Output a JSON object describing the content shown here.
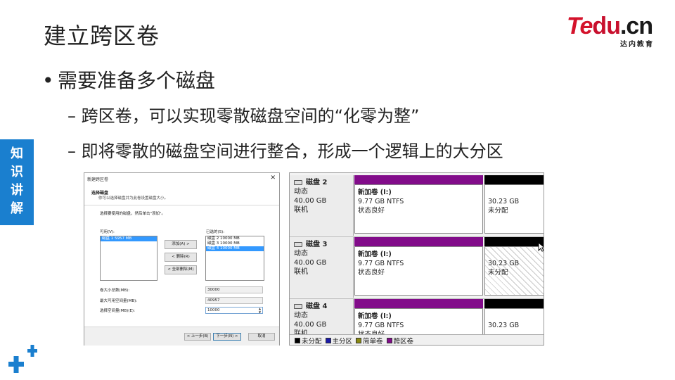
{
  "slide": {
    "title": "建立跨区卷",
    "bullet1": "需要准备多个磁盘",
    "bullet1_mark": "•",
    "sub_bullets": [
      "– 跨区卷，可以实现零散磁盘空间的“化零为整”",
      "– 即将零散的磁盘空间进行整合，形成一个逻辑上的大分区"
    ],
    "side_tab": [
      "知",
      "识",
      "讲",
      "解"
    ],
    "logo": {
      "te": "Te",
      "du": "du",
      "dot": ".",
      "cn": "cn",
      "sub": "达内教育"
    }
  },
  "wizard": {
    "title": "新建跨区卷",
    "header_title": "选择磁盘",
    "header_subtitle": "你可以选择磁盘并为此卷设置磁盘大小。",
    "instruction": "选择要使用的磁盘，然后单击\"添加\"。",
    "available_label": "可用(V):",
    "selected_label": "已选的(S):",
    "available_items": [
      {
        "text": "磁盘 1      5957 MB",
        "selected": true
      }
    ],
    "selected_items": [
      {
        "text": "磁盘 2      10000 MB",
        "selected": false
      },
      {
        "text": "磁盘 3      10000 MB",
        "selected": false
      },
      {
        "text": "磁盘 4      10000 MB",
        "selected": true
      }
    ],
    "add_button": "添加(A) >",
    "remove_button": "< 删除(R)",
    "remove_all_button": "< 全部删除(M)",
    "total_size_label": "卷大小总数(MB):",
    "total_size_value": "30000",
    "max_space_label": "最大可用空间量(MB):",
    "max_space_value": "40957",
    "select_space_label": "选择空间量(MB)(E):",
    "select_space_value": "10000",
    "back_button": "< 上一步(B)",
    "next_button": "下一步(N) >",
    "cancel_button": "取消"
  },
  "disk_management": {
    "disks": [
      {
        "name": "磁盘 2",
        "type": "动态",
        "size": "40.00 GB",
        "status": "联机",
        "volume_name": "新加卷 (I:)",
        "volume_size": "9.77 GB NTFS",
        "volume_status": "状态良好",
        "unallocated_size": "30.23 GB",
        "unallocated_label": "未分配"
      },
      {
        "name": "磁盘 3",
        "type": "动态",
        "size": "40.00 GB",
        "status": "联机",
        "volume_name": "新加卷 (I:)",
        "volume_size": "9.77 GB NTFS",
        "volume_status": "状态良好",
        "unallocated_size": "30.23 GB",
        "unallocated_label": "未分配"
      },
      {
        "name": "磁盘 4",
        "type": "动态",
        "size": "40.00 GB",
        "status": "联机",
        "volume_name": "新加卷 (I:)",
        "volume_size": "9.77 GB NTFS",
        "volume_status": "状态良好",
        "unallocated_size": "30.23 GB",
        "unallocated_label": ""
      }
    ],
    "legend": [
      {
        "label": "未分配",
        "color": "#000000"
      },
      {
        "label": "主分区",
        "color": "#1a1aa8"
      },
      {
        "label": "简单卷",
        "color": "#8a8a12"
      },
      {
        "label": "跨区卷",
        "color": "#820c8a"
      }
    ]
  },
  "colors": {
    "accent_blue": "#1a7fcf",
    "spanned": "#820c8a",
    "logo_red": "#d4122b"
  }
}
